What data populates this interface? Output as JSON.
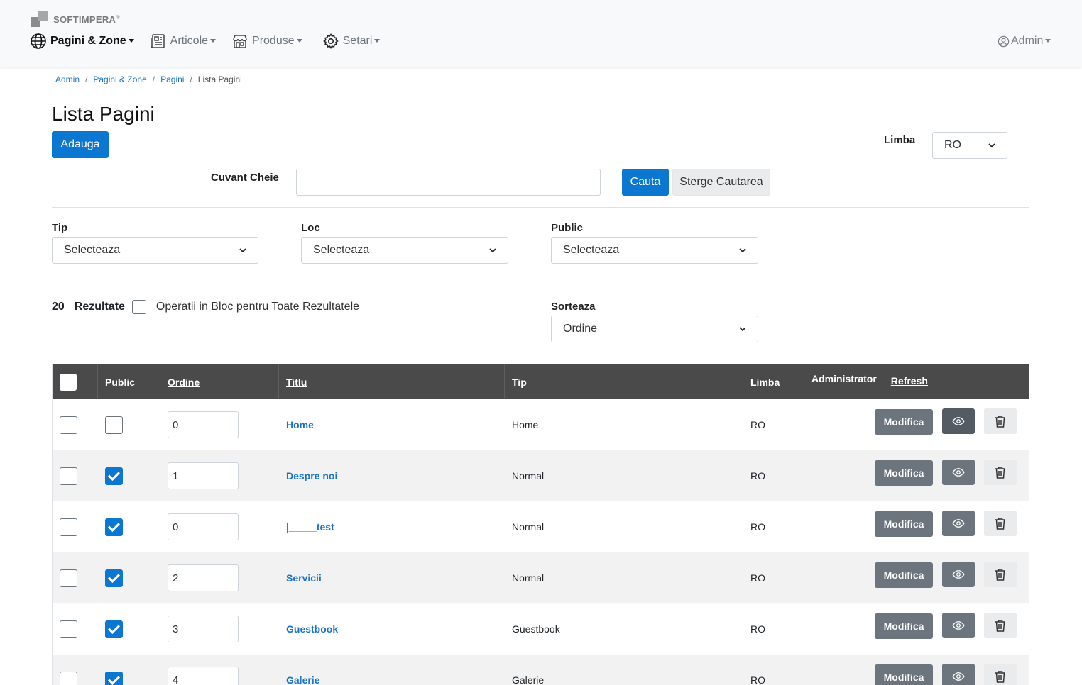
{
  "brand": {
    "name": "SOFTIMPERA",
    "mark": "®"
  },
  "nav": {
    "items": [
      {
        "label": "Pagini & Zone",
        "icon": "globe-icon",
        "active": true
      },
      {
        "label": "Articole",
        "icon": "newspaper-icon",
        "active": false
      },
      {
        "label": "Produse",
        "icon": "shop-icon",
        "active": false
      },
      {
        "label": "Setari",
        "icon": "gear-icon",
        "active": false
      }
    ],
    "user": {
      "label": "Admin",
      "icon": "user-circle-icon"
    }
  },
  "breadcrumb": [
    {
      "label": "Admin"
    },
    {
      "label": "Pagini & Zone"
    },
    {
      "label": "Pagini"
    },
    {
      "label": "Lista Pagini"
    }
  ],
  "page": {
    "title": "Lista Pagini",
    "add_label": "Adauga"
  },
  "language": {
    "label": "Limba",
    "value": "RO"
  },
  "search": {
    "label": "Cuvant Cheie",
    "value": "",
    "placeholder": "",
    "search_label": "Cauta",
    "clear_label": "Sterge Cautarea"
  },
  "filters": {
    "tip": {
      "label": "Tip",
      "value": "Selecteaza"
    },
    "loc": {
      "label": "Loc",
      "value": "Selecteaza"
    },
    "public": {
      "label": "Public",
      "value": "Selecteaza"
    }
  },
  "results": {
    "count": "20",
    "label": "Rezultate",
    "bulk_label": "Operatii in Bloc pentru Toate Rezultatele"
  },
  "sort": {
    "label": "Sorteaza",
    "value": "Ordine"
  },
  "table": {
    "headers": {
      "public": "Public",
      "ordine": "Ordine",
      "titlu": "Titlu",
      "tip": "Tip",
      "limba": "Limba",
      "administrator": "Administrator",
      "refresh": "Refresh"
    },
    "edit_label": "Modifica",
    "rows": [
      {
        "public": false,
        "ordine": "0",
        "titlu": "Home",
        "tip": "Home",
        "limba": "RO"
      },
      {
        "public": true,
        "ordine": "1",
        "titlu": "Despre noi",
        "tip": "Normal",
        "limba": "RO"
      },
      {
        "public": true,
        "ordine": "0",
        "titlu": "|_____test",
        "tip": "Normal",
        "limba": "RO"
      },
      {
        "public": true,
        "ordine": "2",
        "titlu": "Servicii",
        "tip": "Normal",
        "limba": "RO"
      },
      {
        "public": true,
        "ordine": "3",
        "titlu": "Guestbook",
        "tip": "Guestbook",
        "limba": "RO"
      },
      {
        "public": true,
        "ordine": "4",
        "titlu": "Galerie",
        "tip": "Galerie",
        "limba": "RO"
      }
    ]
  },
  "colors": {
    "primary": "#0b77d0",
    "link": "#1a73c8",
    "header_bg": "#4a4a4a",
    "secondary": "#6c757d"
  }
}
